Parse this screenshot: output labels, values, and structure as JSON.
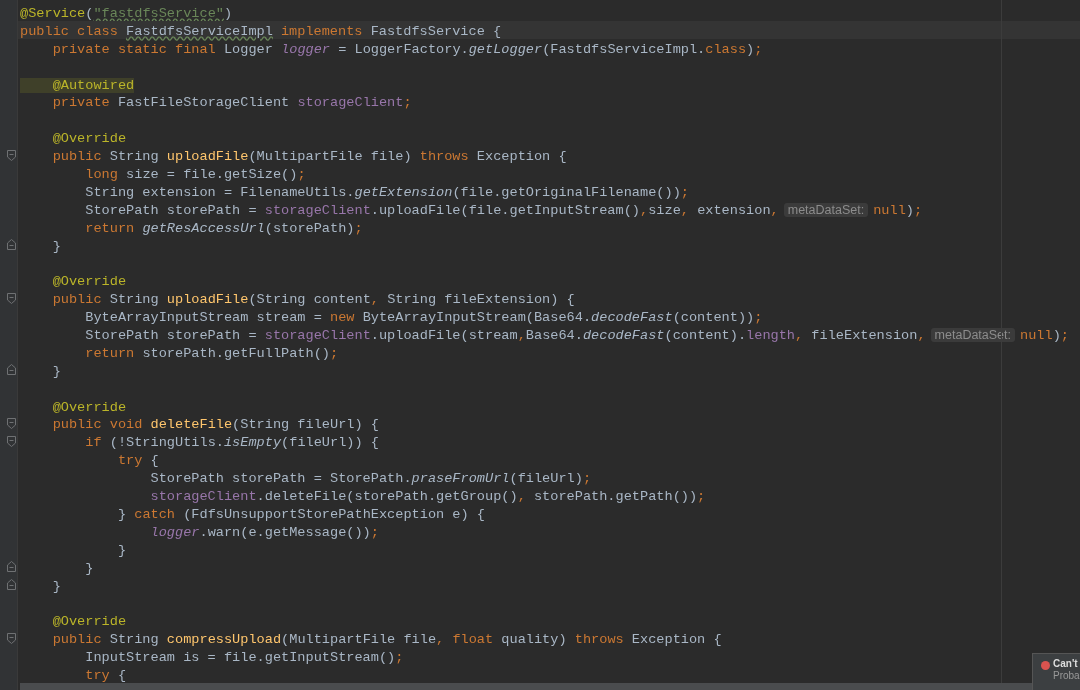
{
  "editor": {
    "lines": [
      {
        "kind": "code",
        "tokens": [
          {
            "text": "@Service",
            "kind": "annotation"
          },
          "(",
          {
            "text": "\"fastdfsService\"",
            "kind": "typo_string"
          },
          ")"
        ]
      },
      {
        "kind": "code",
        "current": true,
        "tokens": [
          {
            "text": "public class ",
            "kind": "keyword"
          },
          {
            "text": "FastdfsServiceImpl",
            "kind": "typo"
          },
          {
            "text": "implements ",
            "kind": "keyword"
          },
          "FastdfsService {"
        ]
      },
      {
        "kind": "code",
        "tokens": [
          {
            "text": "    private static final ",
            "kind": "keyword"
          },
          "Logger ",
          {
            "text": "logger",
            "kind": "static_field"
          },
          " = LoggerFactory.",
          {
            "text": "getLogger",
            "kind": "static_call"
          },
          "(FastdfsServiceImpl.",
          {
            "text": "class",
            "kind": "keyword"
          },
          ")",
          {
            "text": ";",
            "kind": "keyword"
          }
        ]
      },
      {
        "kind": "blank"
      },
      {
        "kind": "code",
        "tokens": [
          {
            "text": "    @Autowired",
            "kind": "marked_annotation"
          }
        ]
      },
      {
        "kind": "code",
        "tokens": [
          {
            "text": "    private ",
            "kind": "keyword"
          },
          "FastFileStorageClient ",
          {
            "text": "storageClient",
            "kind": "field"
          },
          {
            "text": ";",
            "kind": "keyword"
          }
        ]
      },
      {
        "kind": "blank"
      },
      {
        "kind": "code",
        "tokens": [
          {
            "text": "    @Override",
            "kind": "annotation"
          }
        ]
      },
      {
        "kind": "code",
        "fold_start": true,
        "tokens": [
          {
            "text": "    public ",
            "kind": "keyword"
          },
          "String ",
          {
            "text": "uploadFile",
            "kind": "method"
          },
          "(MultipartFile file) ",
          {
            "text": "throws ",
            "kind": "keyword"
          },
          "Exception {"
        ]
      },
      {
        "kind": "code",
        "tokens": [
          {
            "text": "        long ",
            "kind": "keyword"
          },
          "size = file.getSize()",
          {
            "text": ";",
            "kind": "keyword"
          }
        ]
      },
      {
        "kind": "code",
        "tokens": [
          "        String extension = FilenameUtils.",
          {
            "text": "getExtension",
            "kind": "static_call"
          },
          "(file.getOriginalFilename())",
          {
            "text": ";",
            "kind": "keyword"
          }
        ]
      },
      {
        "kind": "code",
        "tokens": [
          "        StorePath storePath = ",
          {
            "text": "storageClient",
            "kind": "field"
          },
          ".uploadFile(file.getInputStream()",
          {
            "text": ",",
            "kind": "keyword"
          },
          "size",
          {
            "text": ",",
            "kind": "keyword"
          },
          " extension",
          {
            "text": ",",
            "kind": "keyword"
          },
          {
            "text": "metaDataSet:",
            "kind": "hint"
          },
          {
            "text": "null",
            "kind": "keyword"
          },
          ")",
          {
            "text": ";",
            "kind": "keyword"
          }
        ]
      },
      {
        "kind": "code",
        "tokens": [
          {
            "text": "        return ",
            "kind": "keyword"
          },
          {
            "text": "getResAccessUrl",
            "kind": "static_call"
          },
          "(storePath)",
          {
            "text": ";",
            "kind": "keyword"
          }
        ]
      },
      {
        "kind": "code",
        "fold_end": true,
        "tokens": [
          "    }"
        ]
      },
      {
        "kind": "blank"
      },
      {
        "kind": "code",
        "tokens": [
          {
            "text": "    @Override",
            "kind": "annotation"
          }
        ]
      },
      {
        "kind": "code",
        "fold_start": true,
        "tokens": [
          {
            "text": "    public ",
            "kind": "keyword"
          },
          "String ",
          {
            "text": "uploadFile",
            "kind": "method"
          },
          "(String content",
          {
            "text": ",",
            "kind": "keyword"
          },
          " String fileExtension) {"
        ]
      },
      {
        "kind": "code",
        "tokens": [
          "        ByteArrayInputStream stream = ",
          {
            "text": "new ",
            "kind": "keyword"
          },
          "ByteArrayInputStream(Base64.",
          {
            "text": "decodeFast",
            "kind": "static_call"
          },
          "(content))",
          {
            "text": ";",
            "kind": "keyword"
          }
        ]
      },
      {
        "kind": "code",
        "tokens": [
          "        StorePath storePath = ",
          {
            "text": "storageClient",
            "kind": "field"
          },
          ".uploadFile(stream",
          {
            "text": ",",
            "kind": "keyword"
          },
          "Base64.",
          {
            "text": "decodeFast",
            "kind": "static_call"
          },
          "(content).",
          {
            "text": "length",
            "kind": "field"
          },
          {
            "text": ",",
            "kind": "keyword"
          },
          " fileExtension",
          {
            "text": ",",
            "kind": "keyword"
          },
          {
            "text": "metaDataSet:",
            "kind": "hint"
          },
          {
            "text": "null",
            "kind": "keyword"
          },
          ")",
          {
            "text": ";",
            "kind": "keyword"
          }
        ]
      },
      {
        "kind": "code",
        "tokens": [
          {
            "text": "        return ",
            "kind": "keyword"
          },
          "storePath.getFullPath()",
          {
            "text": ";",
            "kind": "keyword"
          }
        ]
      },
      {
        "kind": "code",
        "fold_end": true,
        "tokens": [
          "    }"
        ]
      },
      {
        "kind": "blank"
      },
      {
        "kind": "code",
        "tokens": [
          {
            "text": "    @Override",
            "kind": "annotation"
          }
        ]
      },
      {
        "kind": "code",
        "fold_start": true,
        "tokens": [
          {
            "text": "    public void ",
            "kind": "keyword"
          },
          {
            "text": "deleteFile",
            "kind": "method"
          },
          "(String fileUrl) {"
        ]
      },
      {
        "kind": "code",
        "fold_start": true,
        "tokens": [
          {
            "text": "        if ",
            "kind": "keyword"
          },
          "(!StringUtils.",
          {
            "text": "isEmpty",
            "kind": "static_call"
          },
          "(fileUrl)) {"
        ]
      },
      {
        "kind": "code",
        "tokens": [
          {
            "text": "            try ",
            "kind": "keyword"
          },
          "{"
        ]
      },
      {
        "kind": "code",
        "tokens": [
          "                StorePath storePath = StorePath.",
          {
            "text": "praseFromUrl",
            "kind": "static_call"
          },
          "(fileUrl)",
          {
            "text": ";",
            "kind": "keyword"
          }
        ]
      },
      {
        "kind": "code",
        "tokens": [
          {
            "text": "                storageClient",
            "kind": "field"
          },
          ".deleteFile(storePath.getGroup()",
          {
            "text": ",",
            "kind": "keyword"
          },
          " storePath.getPath())",
          {
            "text": ";",
            "kind": "keyword"
          }
        ]
      },
      {
        "kind": "code",
        "tokens": [
          "            } ",
          {
            "text": "catch ",
            "kind": "keyword"
          },
          "(FdfsUnsupportStorePathException e) {"
        ]
      },
      {
        "kind": "code",
        "tokens": [
          {
            "text": "                logger",
            "kind": "static_field"
          },
          ".warn(e.getMessage())",
          {
            "text": ";",
            "kind": "keyword"
          }
        ]
      },
      {
        "kind": "code",
        "tokens": [
          "            }"
        ]
      },
      {
        "kind": "code",
        "fold_end": true,
        "tokens": [
          "        }"
        ]
      },
      {
        "kind": "code",
        "fold_end": true,
        "tokens": [
          "    }"
        ]
      },
      {
        "kind": "blank"
      },
      {
        "kind": "code",
        "tokens": [
          {
            "text": "    @Override",
            "kind": "annotation"
          }
        ]
      },
      {
        "kind": "code",
        "fold_start": true,
        "tokens": [
          {
            "text": "    public ",
            "kind": "keyword"
          },
          "String ",
          {
            "text": "compressUpload",
            "kind": "method"
          },
          "(MultipartFile file",
          {
            "text": ", float ",
            "kind": "keyword"
          },
          "quality) ",
          {
            "text": "throws ",
            "kind": "keyword"
          },
          "Exception {"
        ]
      },
      {
        "kind": "code",
        "tokens": [
          "        InputStream is = file.getInputStream()",
          {
            "text": ";",
            "kind": "keyword"
          }
        ]
      },
      {
        "kind": "code",
        "tokens": [
          {
            "text": "        try ",
            "kind": "keyword"
          },
          "{"
        ]
      }
    ]
  },
  "notification": {
    "title": "Can't",
    "text": "Proba"
  }
}
